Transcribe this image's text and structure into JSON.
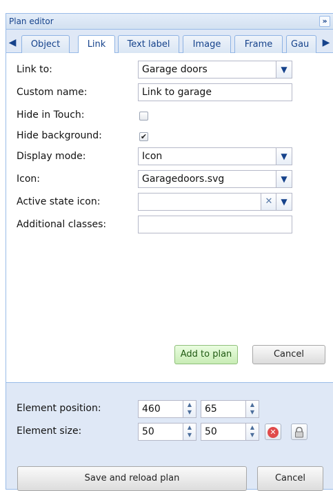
{
  "panel": {
    "title": "Plan editor",
    "collapse_icon": "double-chevron-right-icon"
  },
  "tabs": [
    {
      "label": "Object"
    },
    {
      "label": "Link",
      "active": true
    },
    {
      "label": "Text label"
    },
    {
      "label": "Image"
    },
    {
      "label": "Frame"
    },
    {
      "label": "Gau"
    }
  ],
  "form": {
    "link_to": {
      "label": "Link to:",
      "value": "Garage doors"
    },
    "custom_name": {
      "label": "Custom name:",
      "value": "Link to garage"
    },
    "hide_in_touch": {
      "label": "Hide in Touch:",
      "checked": false
    },
    "hide_background": {
      "label": "Hide background:",
      "checked": true
    },
    "display_mode": {
      "label": "Display mode:",
      "value": "Icon"
    },
    "icon": {
      "label": "Icon:",
      "value": "Garagedoors.svg"
    },
    "active_state_icon": {
      "label": "Active state icon:",
      "value": ""
    },
    "additional_classes": {
      "label": "Additional classes:",
      "value": ""
    },
    "add_button": "Add to plan",
    "cancel_button": "Cancel"
  },
  "bottom": {
    "position_label": "Element position:",
    "position_x": "460",
    "position_y": "65",
    "size_label": "Element size:",
    "size_w": "50",
    "size_h": "50",
    "save_button": "Save and reload plan",
    "cancel_button": "Cancel"
  },
  "glyphs": {
    "chevron_down": "▼",
    "clear": "✕",
    "check": "✔",
    "scroll_left": "🡐",
    "scroll_right": "🡒",
    "collapse": "»",
    "spin": "▲\n▼",
    "delete": "✕"
  }
}
